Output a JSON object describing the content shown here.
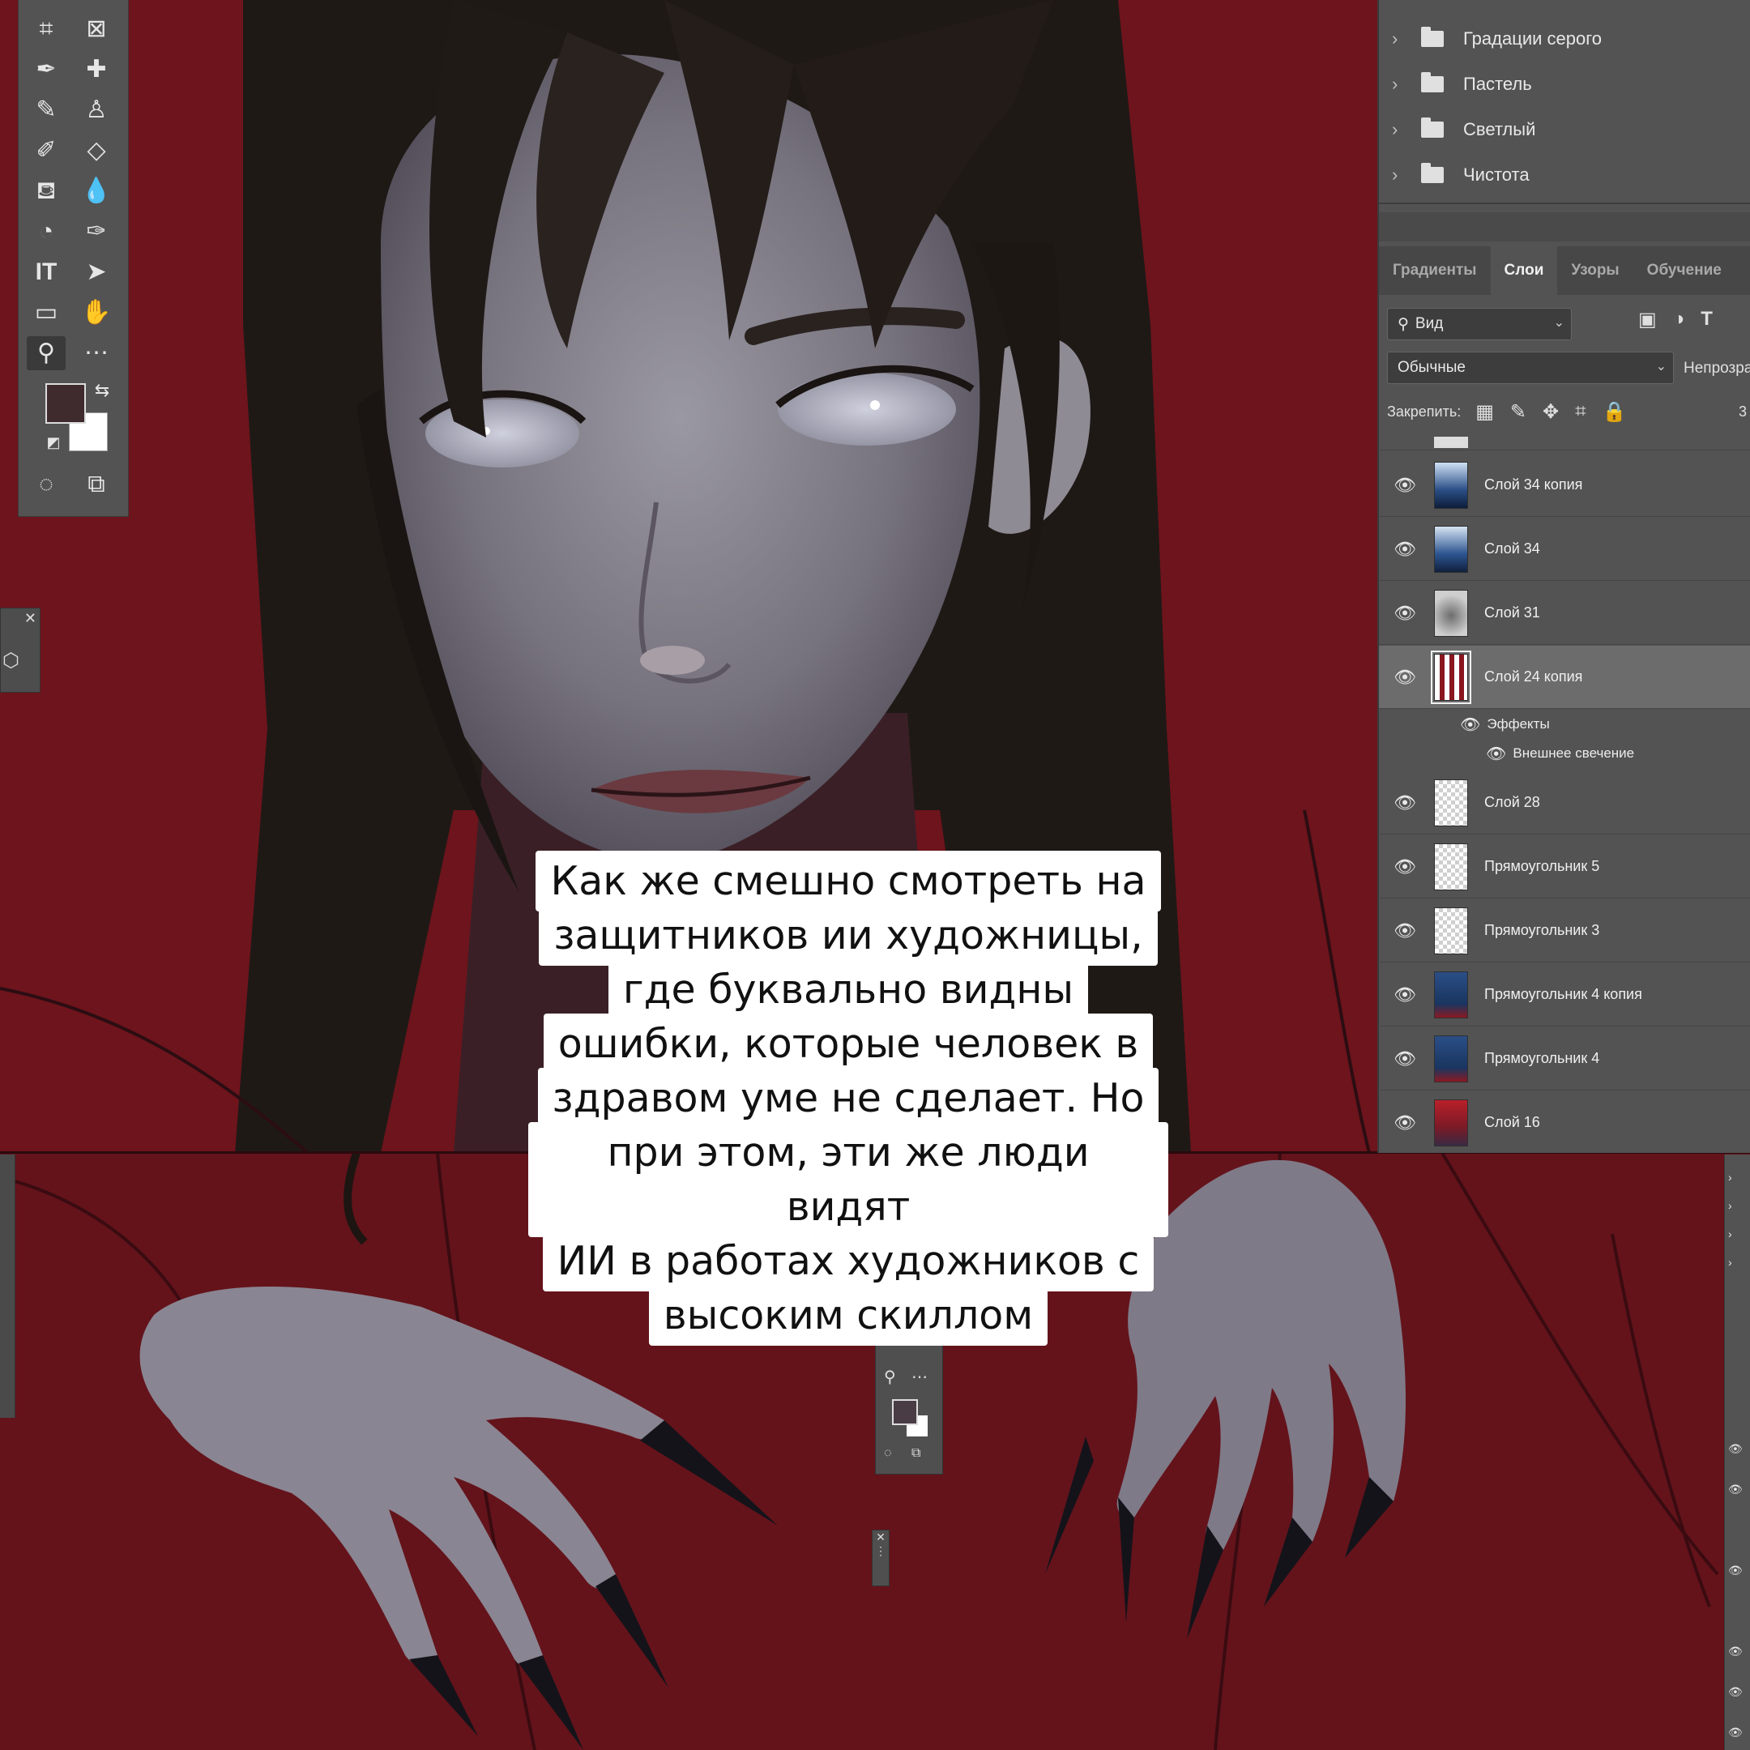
{
  "toolbar": {
    "tools": [
      "crop-icon",
      "frame-icon",
      "eyedropper-icon",
      "healing-brush-icon",
      "brush-icon",
      "stamp-icon",
      "history-brush-icon",
      "eraser-icon",
      "paint-bucket-icon",
      "blur-drop-icon",
      "dodge-icon",
      "pen-icon",
      "type-icon",
      "path-select-icon",
      "rectangle-icon",
      "hand-icon",
      "zoom-icon",
      "more-icon"
    ],
    "foreground_color": "#3f2a2e",
    "background_color": "#ffffff"
  },
  "swatch_groups": [
    "Градации серого",
    "Пастель",
    "Светлый",
    "Чистота"
  ],
  "tabs": [
    {
      "label": "Градиенты",
      "active": false
    },
    {
      "label": "Слои",
      "active": true
    },
    {
      "label": "Узоры",
      "active": false
    },
    {
      "label": "Обучение",
      "active": false
    }
  ],
  "layers_panel": {
    "filter_value": "Вид",
    "blend_mode": "Обычные",
    "opacity_label": "Непрозра",
    "lock_label": "Закрепить:",
    "fill_num": "3",
    "layers": [
      {
        "name": "Слой 34 копия",
        "thumb": "clouds"
      },
      {
        "name": "Слой 34",
        "thumb": "clouds"
      },
      {
        "name": "Слой 31",
        "thumb": "smoke"
      },
      {
        "name": "Слой 24 копия",
        "thumb": "bars",
        "selected": true
      },
      {
        "name": "Слой 28",
        "thumb": "empty"
      },
      {
        "name": "Прямоугольник 5",
        "thumb": "empty"
      },
      {
        "name": "Прямоугольник 3",
        "thumb": "empty"
      },
      {
        "name": "Прямоугольник 4 копия",
        "thumb": "blue"
      },
      {
        "name": "Прямоугольник 4",
        "thumb": "blue"
      },
      {
        "name": "Слой 16",
        "thumb": "red"
      }
    ],
    "effects_label": "Эффекты",
    "outer_glow_label": "Внешнее свечение"
  },
  "caption_lines": [
    "Как же смешно смотреть на",
    "защитников ии художницы,",
    "где буквально видны",
    "ошибки, которые человек в",
    "здравом уме не сделает. Но",
    "при этом, эти же люди видят",
    "ИИ в работах художников с",
    "высоким скиллом"
  ],
  "colors": {
    "canvas_red": "#6e141c",
    "panel_gray": "#535353"
  }
}
